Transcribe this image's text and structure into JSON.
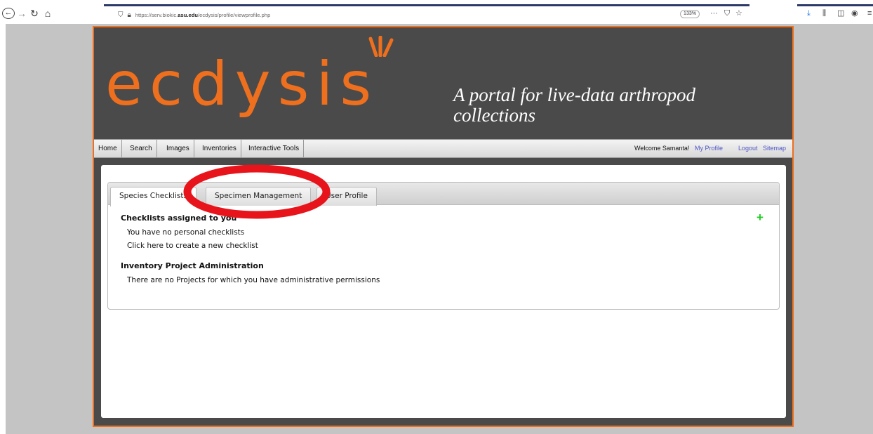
{
  "browser": {
    "url_prefix": "https://serv.biokic.",
    "url_domain": "asu.edu",
    "url_suffix": "/ecdysis/profile/viewprofile.php",
    "zoom": "133%",
    "icons": [
      "back-icon",
      "forward-icon",
      "reload-icon",
      "home-icon",
      "shield-icon",
      "lock-icon",
      "more-icon",
      "pocket-icon",
      "star-icon",
      "download-icon",
      "library-icon",
      "sidebar-icon",
      "account-icon",
      "menu-icon"
    ]
  },
  "site": {
    "logo_text": "ecdysis",
    "tagline": "A portal for live-data arthropod collections",
    "brand_color": "#ee6f1d"
  },
  "nav": {
    "items": [
      "Home",
      "Search",
      "Images",
      "Inventories",
      "Interactive Tools"
    ],
    "welcome": "Welcome Samanta!",
    "my_profile": "My Profile",
    "logout": "Logout",
    "sitemap": "Sitemap"
  },
  "tabs": [
    "Species Checklists",
    "Specimen Management",
    "User Profile"
  ],
  "panel": {
    "checklists_title": "Checklists assigned to you",
    "no_checklists": "You have no personal checklists",
    "create_link": "Click here to create a new checklist",
    "inventory_title": "Inventory Project Administration",
    "no_projects": "There are no Projects for which you have administrative permissions"
  }
}
